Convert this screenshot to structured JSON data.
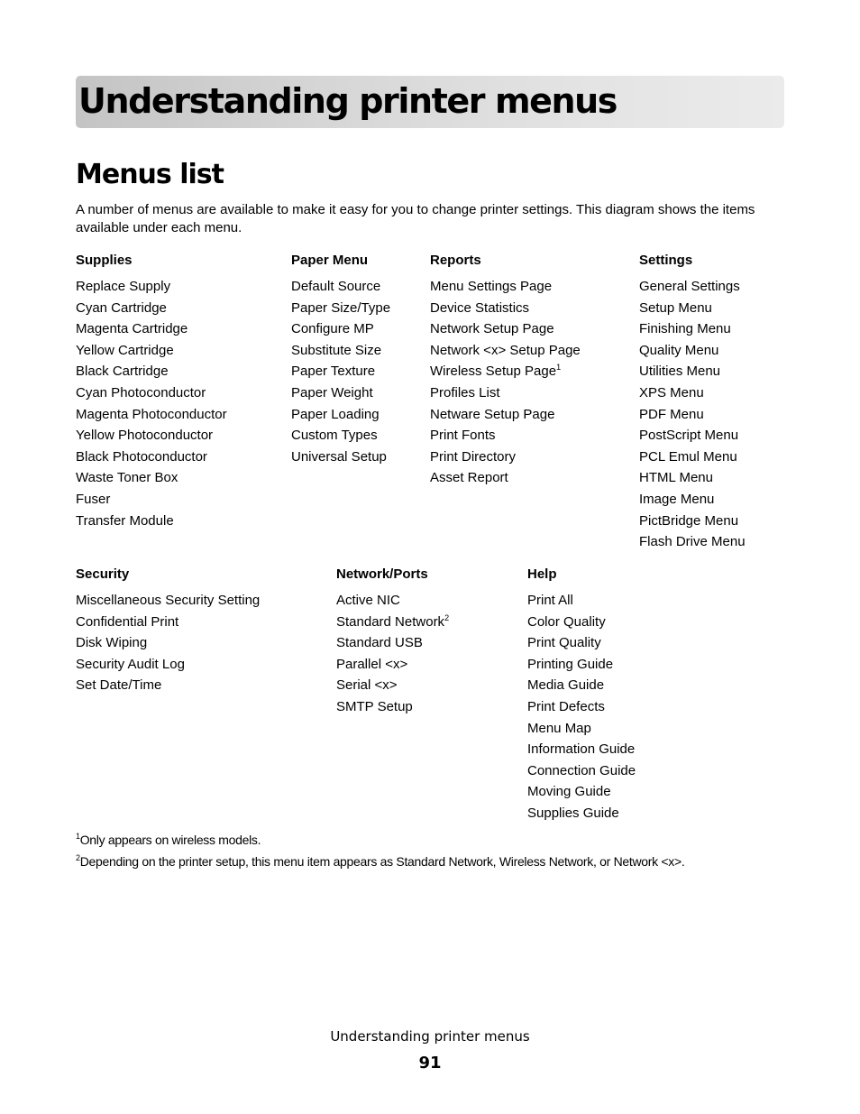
{
  "chapter": {
    "title": "Understanding printer menus"
  },
  "section": {
    "title": "Menus list",
    "intro": "A number of menus are available to make it easy for you to change printer settings. This diagram shows the items available under each menu."
  },
  "menus": {
    "supplies": {
      "title": "Supplies",
      "items": [
        "Replace Supply",
        "Cyan Cartridge",
        "Magenta Cartridge",
        "Yellow Cartridge",
        "Black Cartridge",
        "Cyan Photoconductor",
        "Magenta Photoconductor",
        "Yellow Photoconductor",
        "Black Photoconductor",
        "Waste Toner Box",
        "Fuser",
        "Transfer Module"
      ]
    },
    "paper_menu": {
      "title": "Paper Menu",
      "items": [
        "Default Source",
        "Paper Size/Type",
        "Configure MP",
        "Substitute Size",
        "Paper Texture",
        "Paper Weight",
        "Paper Loading",
        "Custom Types",
        "Universal Setup"
      ]
    },
    "reports": {
      "title": "Reports",
      "items": [
        "Menu Settings Page",
        "Device Statistics",
        "Network Setup Page",
        "Network <x> Setup Page",
        "Wireless Setup Page",
        "Profiles List",
        "Netware Setup Page",
        "Print Fonts",
        "Print Directory",
        "Asset Report"
      ],
      "footnote_marks": {
        "4": "1"
      }
    },
    "settings": {
      "title": "Settings",
      "items": [
        "General Settings",
        "Setup Menu",
        "Finishing Menu",
        "Quality Menu",
        "Utilities Menu",
        "XPS Menu",
        "PDF Menu",
        "PostScript Menu",
        "PCL Emul Menu",
        "HTML Menu",
        "Image Menu",
        "PictBridge Menu",
        "Flash Drive Menu"
      ]
    },
    "security": {
      "title": "Security",
      "items": [
        "Miscellaneous Security Setting",
        "Confidential Print",
        "Disk Wiping",
        "Security Audit Log",
        "Set Date/Time"
      ]
    },
    "network_ports": {
      "title": "Network/Ports",
      "items": [
        "Active NIC",
        "Standard Network",
        "Standard USB",
        "Parallel <x>",
        "Serial <x>",
        "SMTP Setup"
      ],
      "footnote_marks": {
        "1": "2"
      }
    },
    "help": {
      "title": "Help",
      "items": [
        "Print All",
        "Color Quality",
        "Print Quality",
        "Printing Guide",
        "Media Guide",
        "Print Defects",
        "Menu Map",
        "Information Guide",
        "Connection Guide",
        "Moving Guide",
        "Supplies Guide"
      ]
    }
  },
  "footnotes": [
    {
      "mark": "1",
      "text": "Only appears on wireless models."
    },
    {
      "mark": "2",
      "text": "Depending on the printer setup, this menu item appears as Standard Network, Wireless Network, or Network <x>."
    }
  ],
  "footer": {
    "label": "Understanding printer menus",
    "page_number": "91"
  }
}
